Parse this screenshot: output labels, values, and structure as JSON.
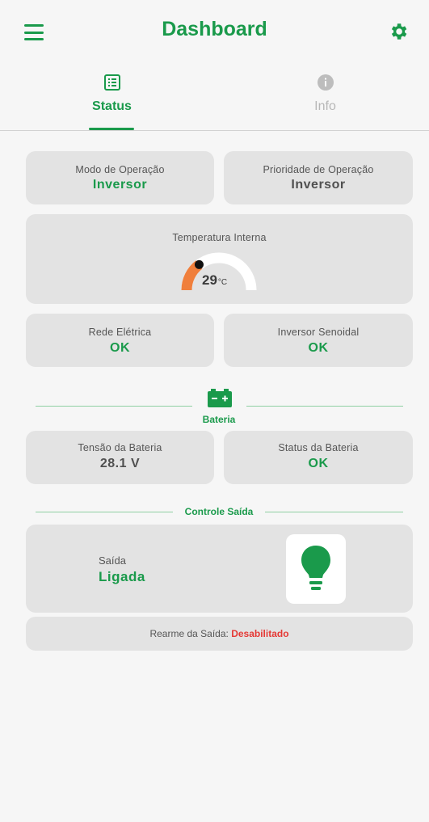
{
  "header": {
    "title": "Dashboard",
    "menu_icon": "hamburger-menu-icon",
    "settings_icon": "gear-icon"
  },
  "tabs": [
    {
      "label": "Status",
      "icon": "list-icon",
      "active": true
    },
    {
      "label": "Info",
      "icon": "info-icon",
      "active": false
    }
  ],
  "operation": {
    "mode_label": "Modo de Operação",
    "mode_value": "Inversor",
    "priority_label": "Prioridade de Operação",
    "priority_value": "Inversor"
  },
  "temperature": {
    "label": "Temperatura Interna",
    "value": "29",
    "unit": "°C",
    "gauge_fraction": 0.29
  },
  "status": {
    "grid_label": "Rede Elétrica",
    "grid_value": "OK",
    "inverter_label": "Inversor Senoidal",
    "inverter_value": "OK"
  },
  "battery": {
    "section_title": "Bateria",
    "section_icon": "battery-icon",
    "voltage_label": "Tensão da Bateria",
    "voltage_value": "28.1 V",
    "status_label": "Status da Bateria",
    "status_value": "OK"
  },
  "output": {
    "section_title": "Controle Saída",
    "label": "Saída",
    "value": "Ligada",
    "bulb_icon": "lightbulb-icon",
    "rearm_label": "Rearme da Saída:",
    "rearm_value": "Desabilitado"
  },
  "colors": {
    "primary": "#1a9a4b",
    "card": "#e3e3e3",
    "gauge": "#f07f3c",
    "danger": "#e53935"
  }
}
